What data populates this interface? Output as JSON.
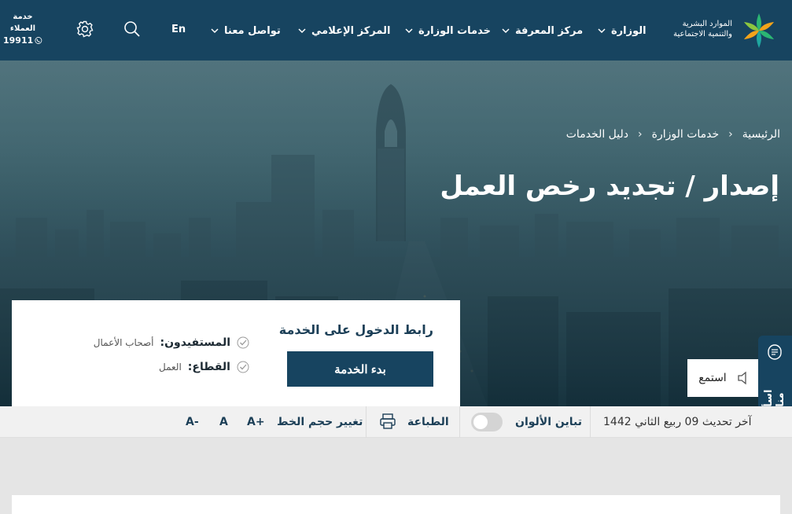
{
  "header": {
    "logo_text_line1": "الموارد البشرية",
    "logo_text_line2": "والتنمية الاجتماعية",
    "nav": [
      {
        "label": "الوزارة"
      },
      {
        "label": "مركز المعرفة"
      },
      {
        "label": "خدمات الوزارة"
      },
      {
        "label": "المركز الإعلامي"
      },
      {
        "label": "تواصل معنا"
      }
    ],
    "language": "En",
    "customer_service_line1": "خدمة",
    "customer_service_line2": "العملاء",
    "customer_service_number": "19911"
  },
  "breadcrumb": {
    "items": [
      "الرئيسية",
      "خدمات الوزارة",
      "دليل الخدمات"
    ]
  },
  "page_title": "إصدار / تجديد رخص العمل",
  "service_card": {
    "link_title": "رابط الدخول على الخدمة",
    "start_button": "بدء الخدمة",
    "beneficiaries_label": "المستفيدون:",
    "beneficiaries_value": "أصحاب الأعمال",
    "sector_label": "القطاع:",
    "sector_value": "العمل"
  },
  "listen_label": "استمع",
  "side_tab_label": "اسأل منال",
  "toolbar": {
    "last_update": "آخر تحديث 09 ربيع الثاني 1442",
    "contrast_label": "تباين الألوان",
    "print_label": "الطباعة",
    "font_size_label": "تغيير حجم الخط",
    "font_increase": "A+",
    "font_normal": "A",
    "font_decrease": "A-"
  },
  "colors": {
    "header_bg": "#174460",
    "accent_green": "#2bb673",
    "accent_orange": "#f2a31b",
    "button_bg": "#174460"
  }
}
